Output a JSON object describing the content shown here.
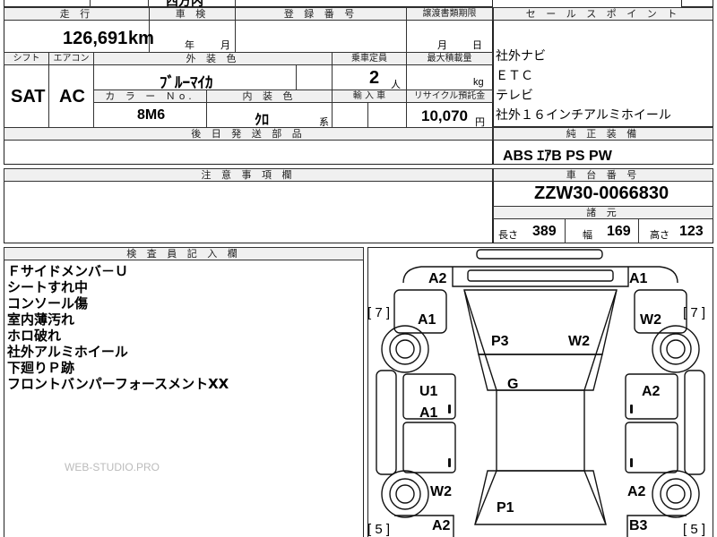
{
  "header": {
    "top_text": "西方内"
  },
  "mileage": {
    "label": "走 行",
    "value": "126,691",
    "unit": "km"
  },
  "inspection": {
    "label": "車 検",
    "year_label": "年",
    "month_label": "月"
  },
  "registration": {
    "label": "登 録 番 号"
  },
  "transfer": {
    "label": "譲渡書類期限",
    "month_label": "月",
    "day_label": "日"
  },
  "shift": {
    "label": "シフト",
    "value": "SAT"
  },
  "aircon": {
    "label": "エアコン",
    "value": "AC"
  },
  "exterior": {
    "label": "外 装 色",
    "value": "ﾌﾞﾙｰﾏｲｶ"
  },
  "capacity": {
    "label": "乗車定員",
    "value": "2",
    "unit": "人"
  },
  "max_load": {
    "label": "最大積載量",
    "unit": "kg"
  },
  "color_no": {
    "label": "カ ラ ー Ｎo.",
    "value": "8M6"
  },
  "interior": {
    "label": "内 装 色",
    "value": "ｸﾛ",
    "suffix": "系"
  },
  "import": {
    "label": "輸 入 車"
  },
  "recycle": {
    "label": "リサイクル預託金",
    "value": "10,070",
    "unit": "円"
  },
  "deferred": {
    "label": "後 日 発 送 部 品"
  },
  "notes": {
    "label": "注 意 事 項 欄"
  },
  "sales_points": {
    "label": "セ ー ル ス ポ イ ン ト",
    "items": [
      "社外ナビ",
      "ＥＴＣ",
      "テレビ",
      "社外１６インチアルミホイール"
    ]
  },
  "equipment": {
    "label": "純 正 装 備",
    "value": "ABS ｴｱB PS PW"
  },
  "chassis": {
    "label": "車 台 番 号",
    "value": "ZZW30-0066830"
  },
  "dimensions": {
    "label": "諸 元",
    "length_label": "長さ",
    "length": "389",
    "width_label": "幅",
    "width": "169",
    "height_label": "高さ",
    "height": "123"
  },
  "inspector": {
    "label": "検 査 員 記 入 欄",
    "lines": [
      "Ｆサイドメンバ－Ｕ",
      "シートすれ中",
      "コンソール傷",
      "室内薄汚れ",
      "ホロ破れ",
      "社外アルミホイール",
      "下廻りＰ跡",
      "フロントバンパーフォースメントXX"
    ]
  },
  "watermark": "WEB-STUDIO.PRO",
  "diagram": {
    "labels": {
      "a2_tl": "A2",
      "a1_tr": "A1",
      "a1_l": "A1",
      "w2_r": "W2",
      "p3": "P3",
      "w2_c": "W2",
      "g": "G",
      "u1": "U1",
      "a2_r": "A2",
      "a1_l2": "A1",
      "w2_bl": "W2",
      "a2_br": "A2",
      "p1": "P1",
      "a2_b": "A2",
      "b3": "B3"
    },
    "brackets": {
      "left_top": "[ 7 ]",
      "right_top": "[ 7 ]",
      "left_bottom": "[ 5 ]",
      "right_bottom": "[ 5 ]"
    }
  }
}
